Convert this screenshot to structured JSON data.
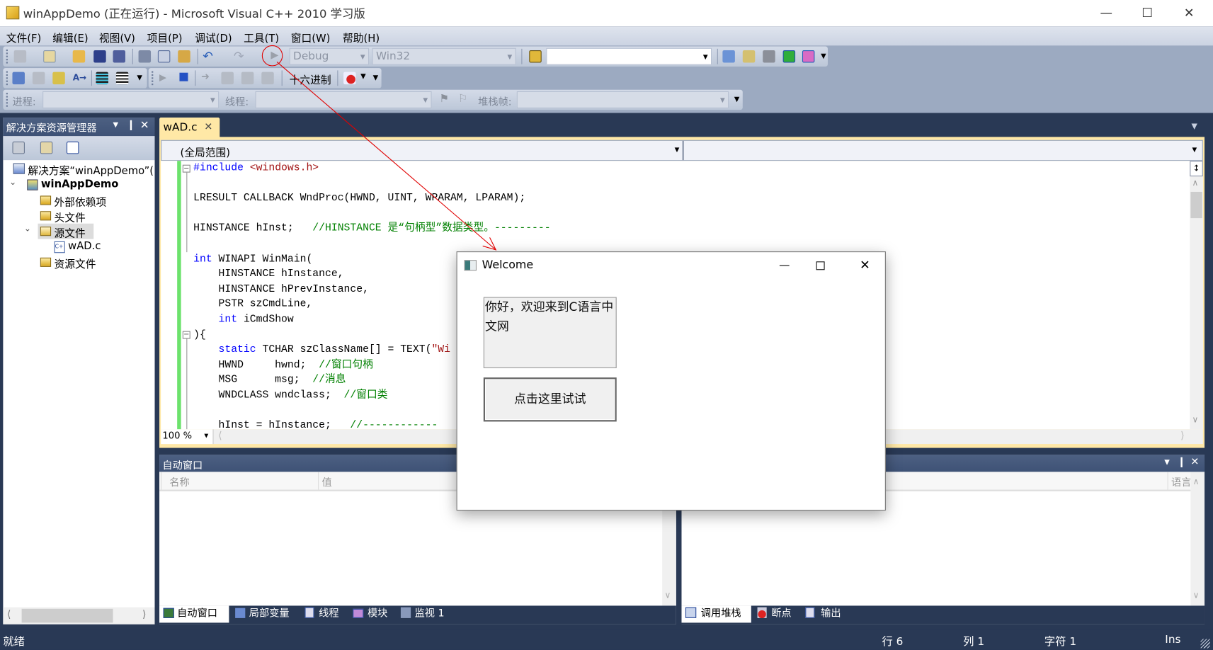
{
  "window": {
    "title": "winAppDemo (正在运行) - Microsoft Visual C++ 2010 学习版",
    "controls": [
      "minimize",
      "maximize",
      "close"
    ]
  },
  "menu": [
    "文件(F)",
    "编辑(E)",
    "视图(V)",
    "项目(P)",
    "调试(D)",
    "工具(T)",
    "窗口(W)",
    "帮助(H)"
  ],
  "toolbar": {
    "config": "Debug",
    "platform": "Win32",
    "find_value": "",
    "hex_label": "十六进制",
    "process_label": "进程:",
    "thread_label": "线程:",
    "stackframe_label": "堆栈帧:"
  },
  "solution_explorer": {
    "title": "解决方案资源管理器",
    "items": [
      {
        "label": "解决方案“winAppDemo”(",
        "icon": "solution-icon"
      },
      {
        "label": "winAppDemo",
        "icon": "project-icon"
      },
      {
        "label": "外部依赖项",
        "icon": "folder-icon"
      },
      {
        "label": "头文件",
        "icon": "folder-icon"
      },
      {
        "label": "源文件",
        "icon": "folder-open-icon"
      },
      {
        "label": "wAD.c",
        "icon": "cpp-file-icon"
      },
      {
        "label": "资源文件",
        "icon": "folder-icon"
      }
    ]
  },
  "editor": {
    "tab": "wAD.c",
    "scope": "(全局范围)",
    "member": "",
    "zoom": "100 %",
    "lines": [
      [
        [
          "kw",
          "#include "
        ],
        [
          "st",
          "<windows.h>"
        ]
      ],
      [],
      [
        [
          "pl",
          "LRESULT CALLBACK WndProc(HWND, UINT, WPARAM, LPARAM);"
        ]
      ],
      [],
      [
        [
          "pl",
          "HINSTANCE hInst;   "
        ],
        [
          "cm",
          "//HINSTANCE 是“句柄型”数据类型。---------"
        ]
      ],
      [],
      [
        [
          "kw",
          "int"
        ],
        [
          "pl",
          " WINAPI WinMain("
        ]
      ],
      [
        [
          "pl",
          "    HINSTANCE hInstance,"
        ]
      ],
      [
        [
          "pl",
          "    HINSTANCE hPrevInstance,"
        ]
      ],
      [
        [
          "pl",
          "    PSTR szCmdLine,"
        ]
      ],
      [
        [
          "pl",
          "    "
        ],
        [
          "kw",
          "int"
        ],
        [
          "pl",
          " iCmdShow"
        ]
      ],
      [
        [
          "pl",
          "){"
        ]
      ],
      [
        [
          "pl",
          "    "
        ],
        [
          "kw",
          "static"
        ],
        [
          "pl",
          " TCHAR szClassName[] = TEXT("
        ],
        [
          "st",
          "\"Wi"
        ]
      ],
      [
        [
          "pl",
          "    HWND     hwnd;  "
        ],
        [
          "cm",
          "//窗口句柄"
        ]
      ],
      [
        [
          "pl",
          "    MSG      msg;  "
        ],
        [
          "cm",
          "//消息"
        ]
      ],
      [
        [
          "pl",
          "    WNDCLASS wndclass;  "
        ],
        [
          "cm",
          "//窗口类"
        ]
      ],
      [],
      [
        [
          "pl",
          "    hInst = hInstance;   "
        ],
        [
          "cm",
          "//------------"
        ]
      ]
    ]
  },
  "autos": {
    "title": "自动窗口",
    "columns": [
      "名称",
      "值"
    ],
    "tabs": [
      "自动窗口",
      "局部变量",
      "线程",
      "模块",
      "监视 1"
    ]
  },
  "callstack": {
    "columns": [
      "语言"
    ],
    "tabs": [
      "调用堆栈",
      "断点",
      "输出"
    ]
  },
  "status": {
    "text": "就绪",
    "line": "行 6",
    "col": "列 1",
    "char": "字符 1",
    "mode": "Ins"
  },
  "dialog": {
    "title": "Welcome",
    "static_text": "你好，欢迎来到C语言中文网",
    "button": "点击这里试试"
  },
  "colors": {
    "ide_dark": "#293955",
    "toolbar": "#9caac1",
    "tab_active": "#ffe8a6",
    "keyword": "#0000ff",
    "comment": "#008000",
    "string": "#a31515",
    "annotation": "#e00000"
  }
}
